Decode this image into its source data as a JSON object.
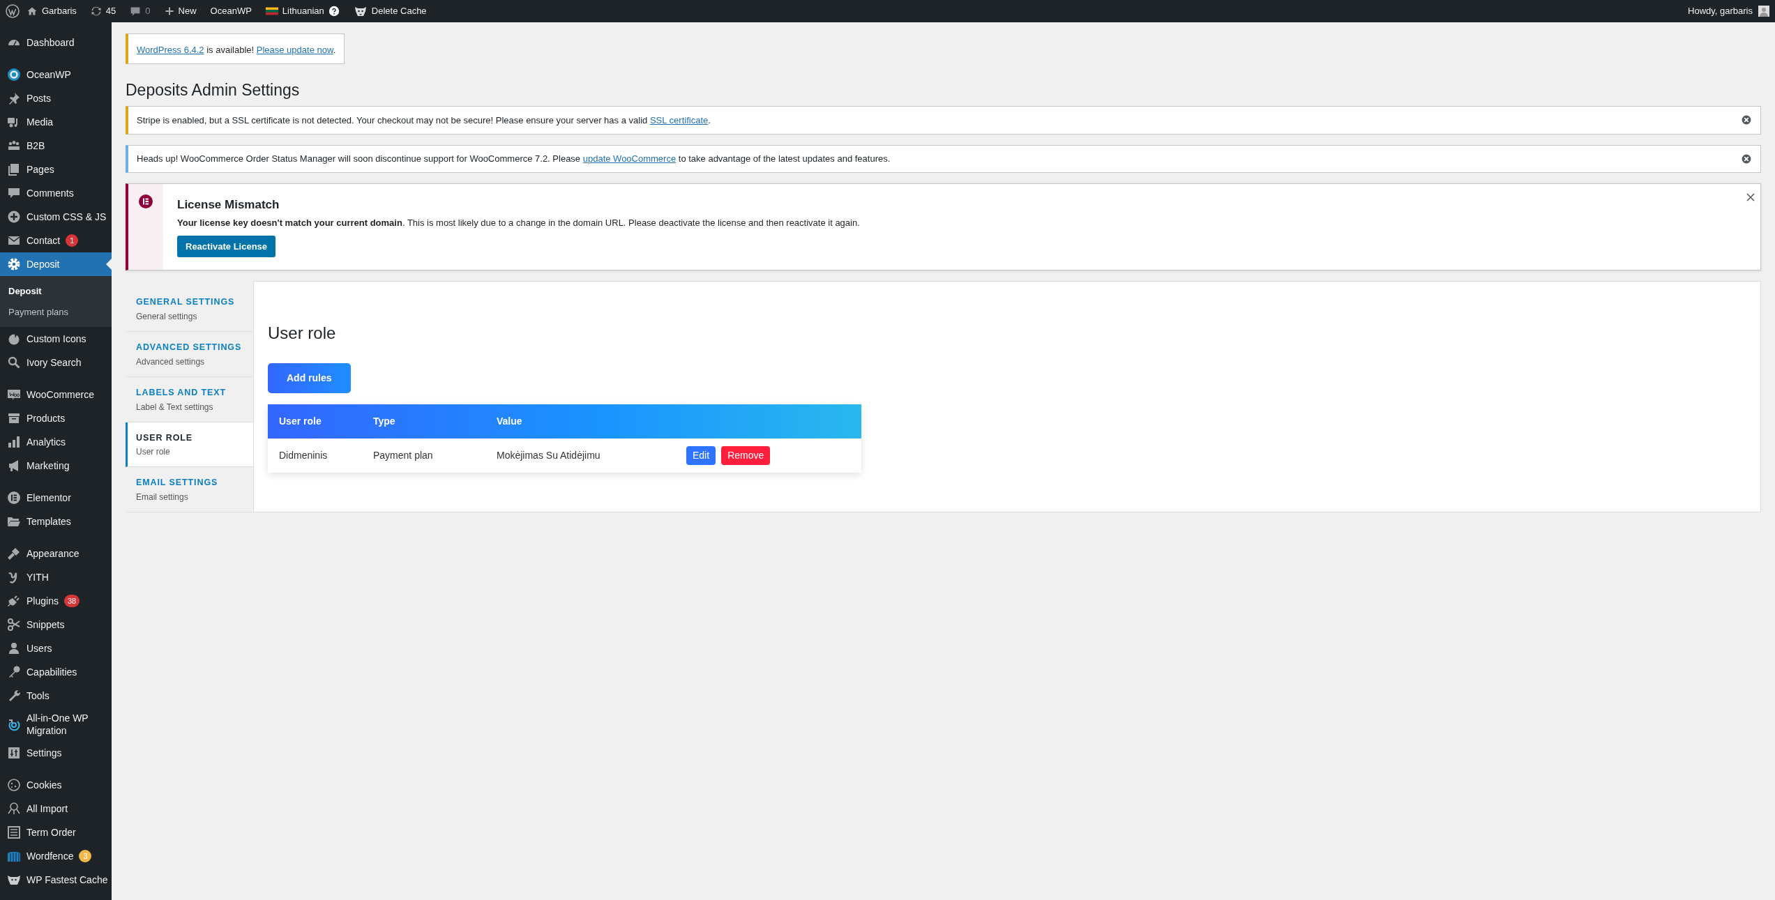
{
  "admin_bar": {
    "items": [
      {
        "kind": "site",
        "label": "Garbaris"
      },
      {
        "kind": "updates",
        "label": "45"
      },
      {
        "kind": "comments",
        "label": "0"
      },
      {
        "kind": "new",
        "label": "New"
      },
      {
        "kind": "plain",
        "label": "OceanWP"
      },
      {
        "kind": "language",
        "label": "Lithuanian"
      },
      {
        "kind": "cache",
        "label": "Delete Cache"
      }
    ],
    "account": "Howdy, garbaris"
  },
  "sidebar": {
    "groups": [
      [
        {
          "label": "Dashboard",
          "selected": false
        }
      ],
      [
        {
          "label": "OceanWP",
          "selected": false
        },
        {
          "label": "Posts",
          "selected": false
        },
        {
          "label": "Media",
          "selected": false
        },
        {
          "label": "B2B",
          "selected": false
        },
        {
          "label": "Pages",
          "selected": false
        },
        {
          "label": "Comments",
          "selected": false
        },
        {
          "label": "Custom CSS & JS",
          "selected": false
        },
        {
          "label": "Contact",
          "selected": false,
          "badge": {
            "text": "1",
            "color": "#d63638"
          }
        },
        {
          "label": "Deposit",
          "selected": true,
          "children": [
            {
              "label": "Deposit",
              "selected": true
            },
            {
              "label": "Payment plans",
              "selected": false
            }
          ]
        },
        {
          "label": "Custom Icons",
          "selected": false
        },
        {
          "label": "Ivory Search",
          "selected": false
        }
      ],
      [
        {
          "label": "WooCommerce",
          "selected": false
        },
        {
          "label": "Products",
          "selected": false
        },
        {
          "label": "Analytics",
          "selected": false
        },
        {
          "label": "Marketing",
          "selected": false
        }
      ],
      [
        {
          "label": "Elementor",
          "selected": false
        },
        {
          "label": "Templates",
          "selected": false
        }
      ],
      [
        {
          "label": "Appearance",
          "selected": false
        },
        {
          "label": "YITH",
          "selected": false
        },
        {
          "label": "Plugins",
          "selected": false,
          "badge": {
            "text": "38",
            "color": "#d63638"
          }
        },
        {
          "label": "Snippets",
          "selected": false
        },
        {
          "label": "Users",
          "selected": false
        },
        {
          "label": "Capabilities",
          "selected": false
        },
        {
          "label": "Tools",
          "selected": false
        },
        {
          "label": "All-in-One WP Migration",
          "selected": false
        },
        {
          "label": "Settings",
          "selected": false
        }
      ],
      [
        {
          "label": "Cookies",
          "selected": false
        },
        {
          "label": "All Import",
          "selected": false
        },
        {
          "label": "Term Order",
          "selected": false
        },
        {
          "label": "Wordfence",
          "selected": false,
          "badge": {
            "text": "3",
            "color": "#f0b849"
          }
        },
        {
          "label": "WP Fastest Cache",
          "selected": false
        }
      ]
    ]
  },
  "update_notice": {
    "kind": "warning",
    "parts": [
      {
        "kind": "link",
        "text": "WordPress 6.4.2"
      },
      {
        "kind": "text",
        "text": " is available! "
      },
      {
        "kind": "link",
        "text": "Please update now"
      },
      {
        "kind": "text",
        "text": "."
      }
    ]
  },
  "page_title": "Deposits Admin Settings",
  "notices": [
    {
      "kind": "warning",
      "parts": [
        {
          "kind": "text",
          "text": "Stripe is enabled, but a SSL certificate is not detected. Your checkout may not be secure! Please ensure your server has a valid "
        },
        {
          "kind": "link",
          "text": "SSL certificate"
        },
        {
          "kind": "text",
          "text": "."
        }
      ]
    },
    {
      "kind": "info",
      "parts": [
        {
          "kind": "text",
          "text": "Heads up! WooCommerce Order Status Manager will soon discontinue support for WooCommerce 7.2. Please "
        },
        {
          "kind": "link",
          "text": "update WooCommerce"
        },
        {
          "kind": "text",
          "text": " to take advantage of the latest updates and features."
        }
      ]
    }
  ],
  "license_notice": {
    "title": "License Mismatch",
    "message": "**Your license key doesn't match your current domain**. This is most likely due to a change in the domain URL. Please deactivate the license and then reactivate it again.",
    "button": "Reactivate License"
  },
  "settings_tabs": [
    {
      "title": "GENERAL SETTINGS",
      "subtitle": "General settings",
      "selected": false
    },
    {
      "title": "ADVANCED SETTINGS",
      "subtitle": "Advanced settings",
      "selected": false
    },
    {
      "title": "LABELS AND TEXT",
      "subtitle": "Label & Text settings",
      "selected": false
    },
    {
      "title": "USER ROLE",
      "subtitle": "User role",
      "selected": true
    },
    {
      "title": "EMAIL SETTINGS",
      "subtitle": "Email settings",
      "selected": false
    }
  ],
  "panel": {
    "title": "User role",
    "add_button": "Add rules",
    "table": {
      "columns": [
        "User role",
        "Type",
        "Value"
      ],
      "rows": [
        {
          "cells": [
            "Didmeninis",
            "Payment plan",
            "Mokėjimas Su Atidėjimu"
          ],
          "actions": [
            {
              "kind": "edit",
              "label": "Edit"
            },
            {
              "kind": "remove",
              "label": "Remove"
            }
          ]
        }
      ]
    }
  }
}
